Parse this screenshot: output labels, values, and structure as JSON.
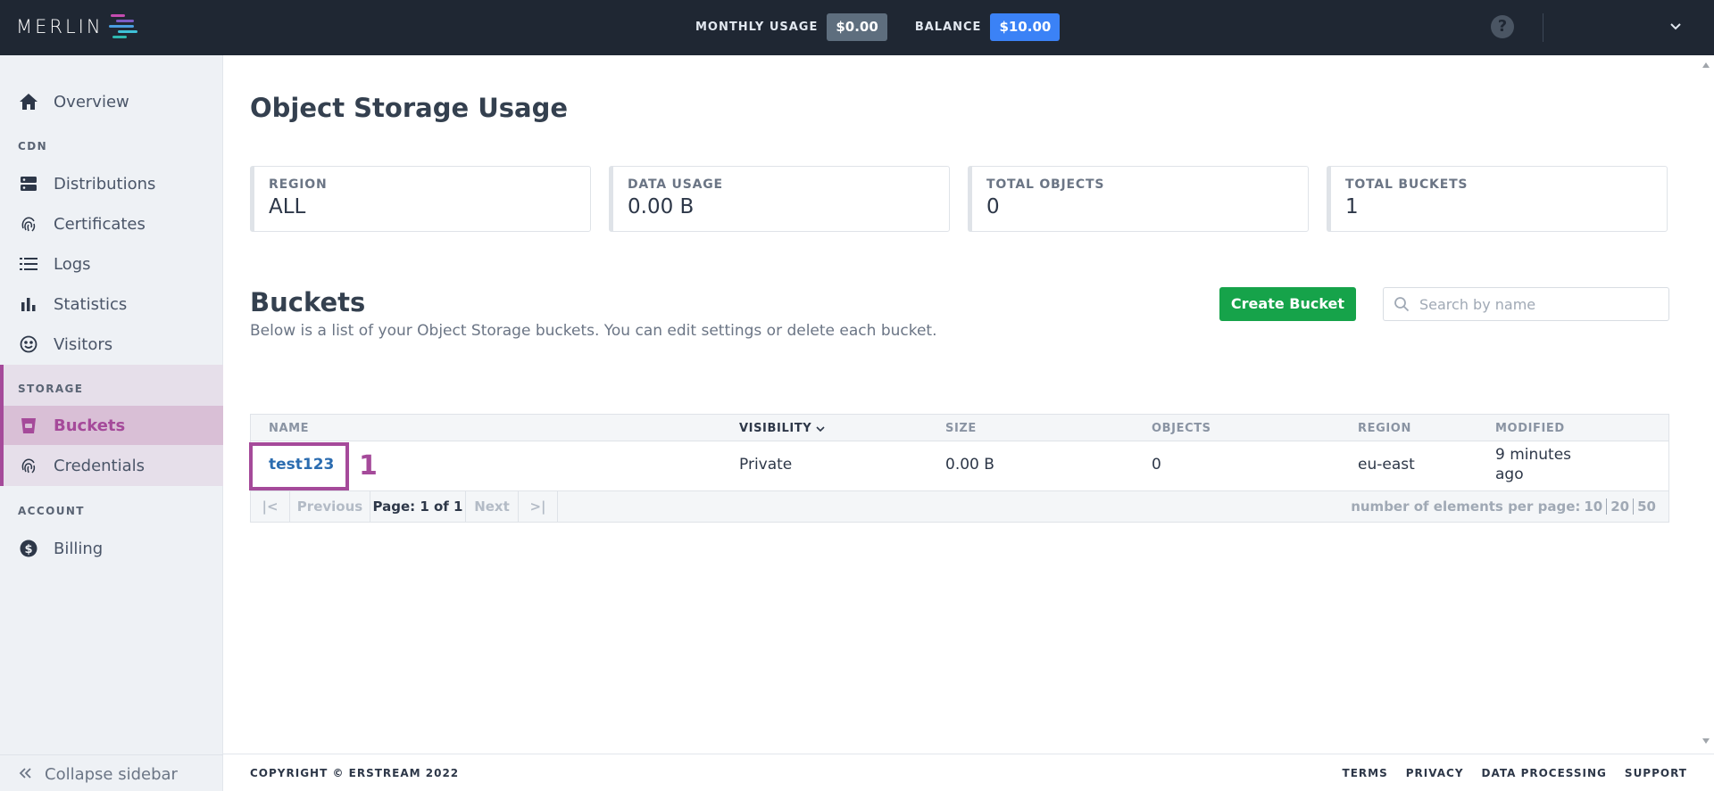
{
  "app": {
    "logo_text": "MERLIN",
    "monthly_usage_label": "MONTHLY USAGE",
    "monthly_usage_value": "$0.00",
    "balance_label": "BALANCE",
    "balance_value": "$10.00",
    "help_icon": "?"
  },
  "sidebar": {
    "overview": "Overview",
    "cdn_label": "CDN",
    "distributions": "Distributions",
    "certificates": "Certificates",
    "logs": "Logs",
    "statistics": "Statistics",
    "visitors": "Visitors",
    "storage_label": "STORAGE",
    "buckets": "Buckets",
    "credentials": "Credentials",
    "account_label": "ACCOUNT",
    "billing": "Billing",
    "collapse": "Collapse sidebar"
  },
  "page": {
    "title": "Object Storage Usage"
  },
  "stats": [
    {
      "label": "REGION",
      "value": "ALL"
    },
    {
      "label": "DATA USAGE",
      "value": "0.00 B"
    },
    {
      "label": "TOTAL OBJECTS",
      "value": "0"
    },
    {
      "label": "TOTAL BUCKETS",
      "value": "1"
    }
  ],
  "buckets": {
    "title": "Buckets",
    "subtitle": "Below is a list of your Object Storage buckets. You can edit settings or delete each bucket.",
    "create_label": "Create Bucket",
    "search_placeholder": "Search by name",
    "columns": {
      "name": "NAME",
      "visibility": "VISIBILITY",
      "size": "SIZE",
      "objects": "OBJECTS",
      "region": "REGION",
      "modified": "MODIFIED"
    },
    "rows": [
      {
        "name": "test123",
        "visibility": "Private",
        "size": "0.00 B",
        "objects": "0",
        "region": "eu-east",
        "modified_1": "9 minutes",
        "modified_2": "ago"
      }
    ],
    "annotation": "1"
  },
  "pager": {
    "first": "|<",
    "previous": "Previous",
    "page": "Page: 1 of 1",
    "next": "Next",
    "last": ">|",
    "per_page_label": "number of elements per page:",
    "opts": [
      "10",
      "20",
      "50"
    ]
  },
  "footer": {
    "copyright": "COPYRIGHT © ERSTREAM 2022",
    "terms": "TERMS",
    "privacy": "PRIVACY",
    "data_processing": "DATA PROCESSING",
    "support": "SUPPORT"
  },
  "colors": {
    "topbar": "#1f2733",
    "accent": "#a54a9a",
    "primary_button": "#16a34a",
    "balance_badge": "#3b82f6"
  }
}
